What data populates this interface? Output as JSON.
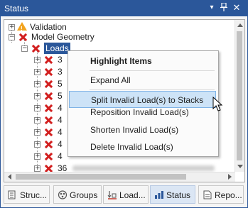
{
  "window": {
    "title": "Status"
  },
  "tree": {
    "validation_label": "Validation",
    "model_geometry_label": "Model Geometry",
    "loads_label": "Loads",
    "load_items": [
      "3",
      "3",
      "5",
      "5",
      "4",
      "4",
      "4",
      "4",
      "4",
      "4",
      "36"
    ]
  },
  "context_menu": {
    "header": "Highlight Items",
    "items": [
      "Expand All",
      "Split Invalid Load(s) to Stacks",
      "Reposition Invalid Load(s)",
      "Shorten Invalid Load(s)",
      "Delete Invalid Load(s)"
    ]
  },
  "tabs": [
    {
      "label": "Struc...",
      "icon": "structure-icon",
      "active": false
    },
    {
      "label": "Groups",
      "icon": "groups-icon",
      "active": false
    },
    {
      "label": "Load...",
      "icon": "loads-icon",
      "active": false
    },
    {
      "label": "Status",
      "icon": "status-icon",
      "active": true
    },
    {
      "label": "Repo...",
      "icon": "report-icon",
      "active": false
    }
  ],
  "colors": {
    "accent": "#2b579a",
    "error": "#d21f1f",
    "warning": "#f2a31d",
    "menu_highlight": "#cde3f7"
  }
}
